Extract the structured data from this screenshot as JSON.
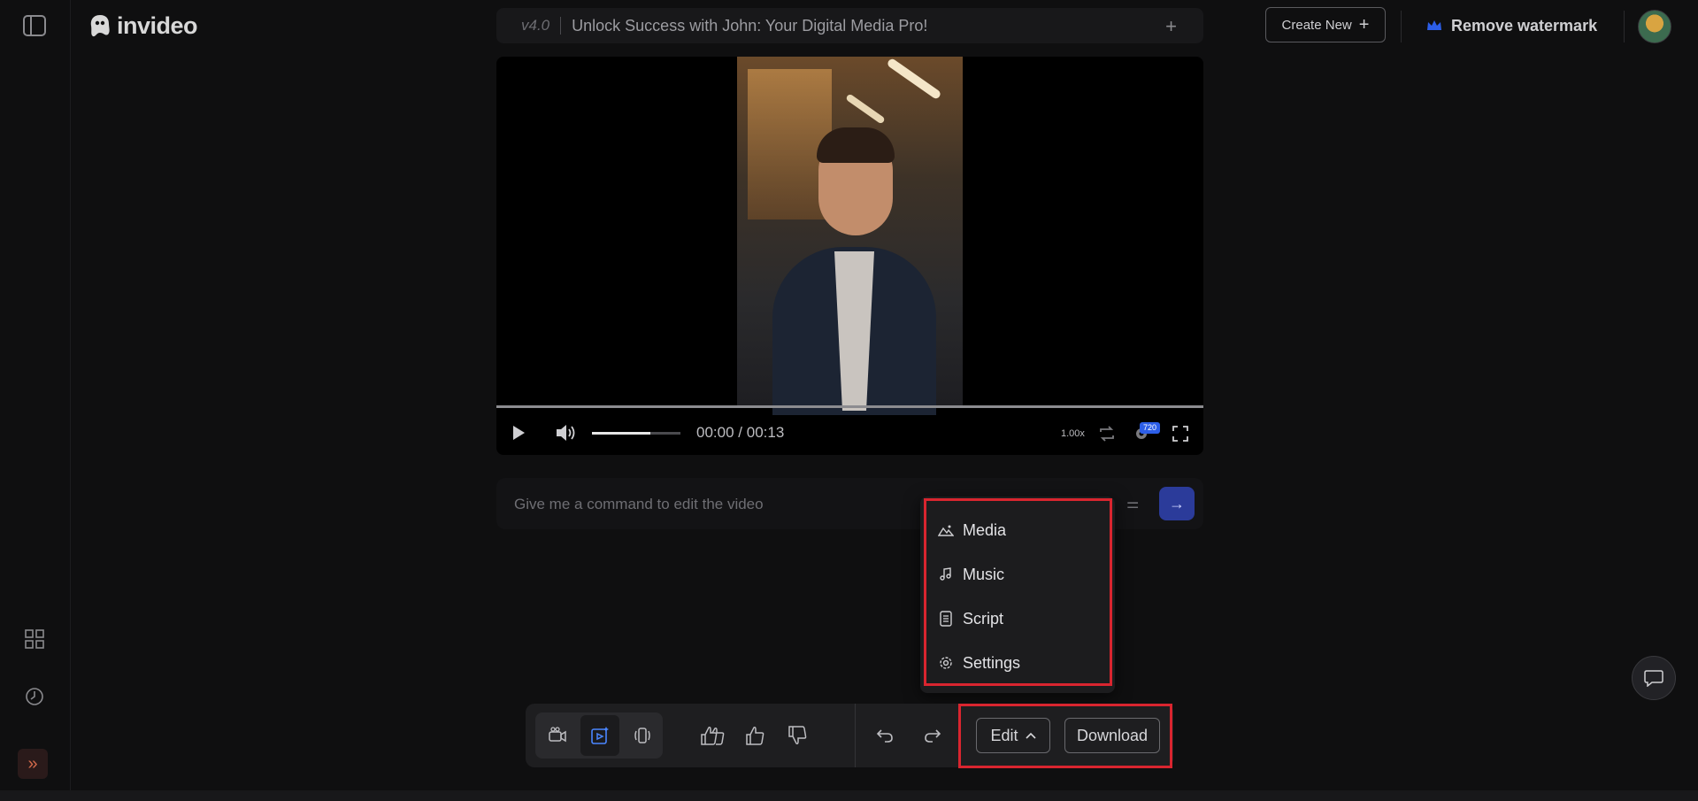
{
  "app": {
    "logo_text": "invideo"
  },
  "header": {
    "version": "v4.0",
    "project_title": "Unlock Success with John: Your Digital Media Pro!",
    "add_icon": "plus-icon",
    "create_new_label": "Create New",
    "remove_watermark_label": "Remove watermark"
  },
  "player": {
    "current_time": "00:00",
    "separator": "/",
    "duration": "00:13",
    "speed": "1.00x",
    "quality_badge": "720",
    "volume_level": 0.66,
    "progress": 0
  },
  "command": {
    "placeholder": "Give me a command to edit the video"
  },
  "edit_menu": {
    "items": [
      {
        "label": "Media",
        "icon": "media-icon"
      },
      {
        "label": "Music",
        "icon": "music-note-icon"
      },
      {
        "label": "Script",
        "icon": "script-icon"
      },
      {
        "label": "Settings",
        "icon": "gear-icon"
      }
    ]
  },
  "toolbar": {
    "edit_label": "Edit",
    "download_label": "Download"
  },
  "colors": {
    "accent_blue": "#2c5ee8",
    "highlight_red": "#d9252f",
    "send_button": "#2b3b9a"
  }
}
